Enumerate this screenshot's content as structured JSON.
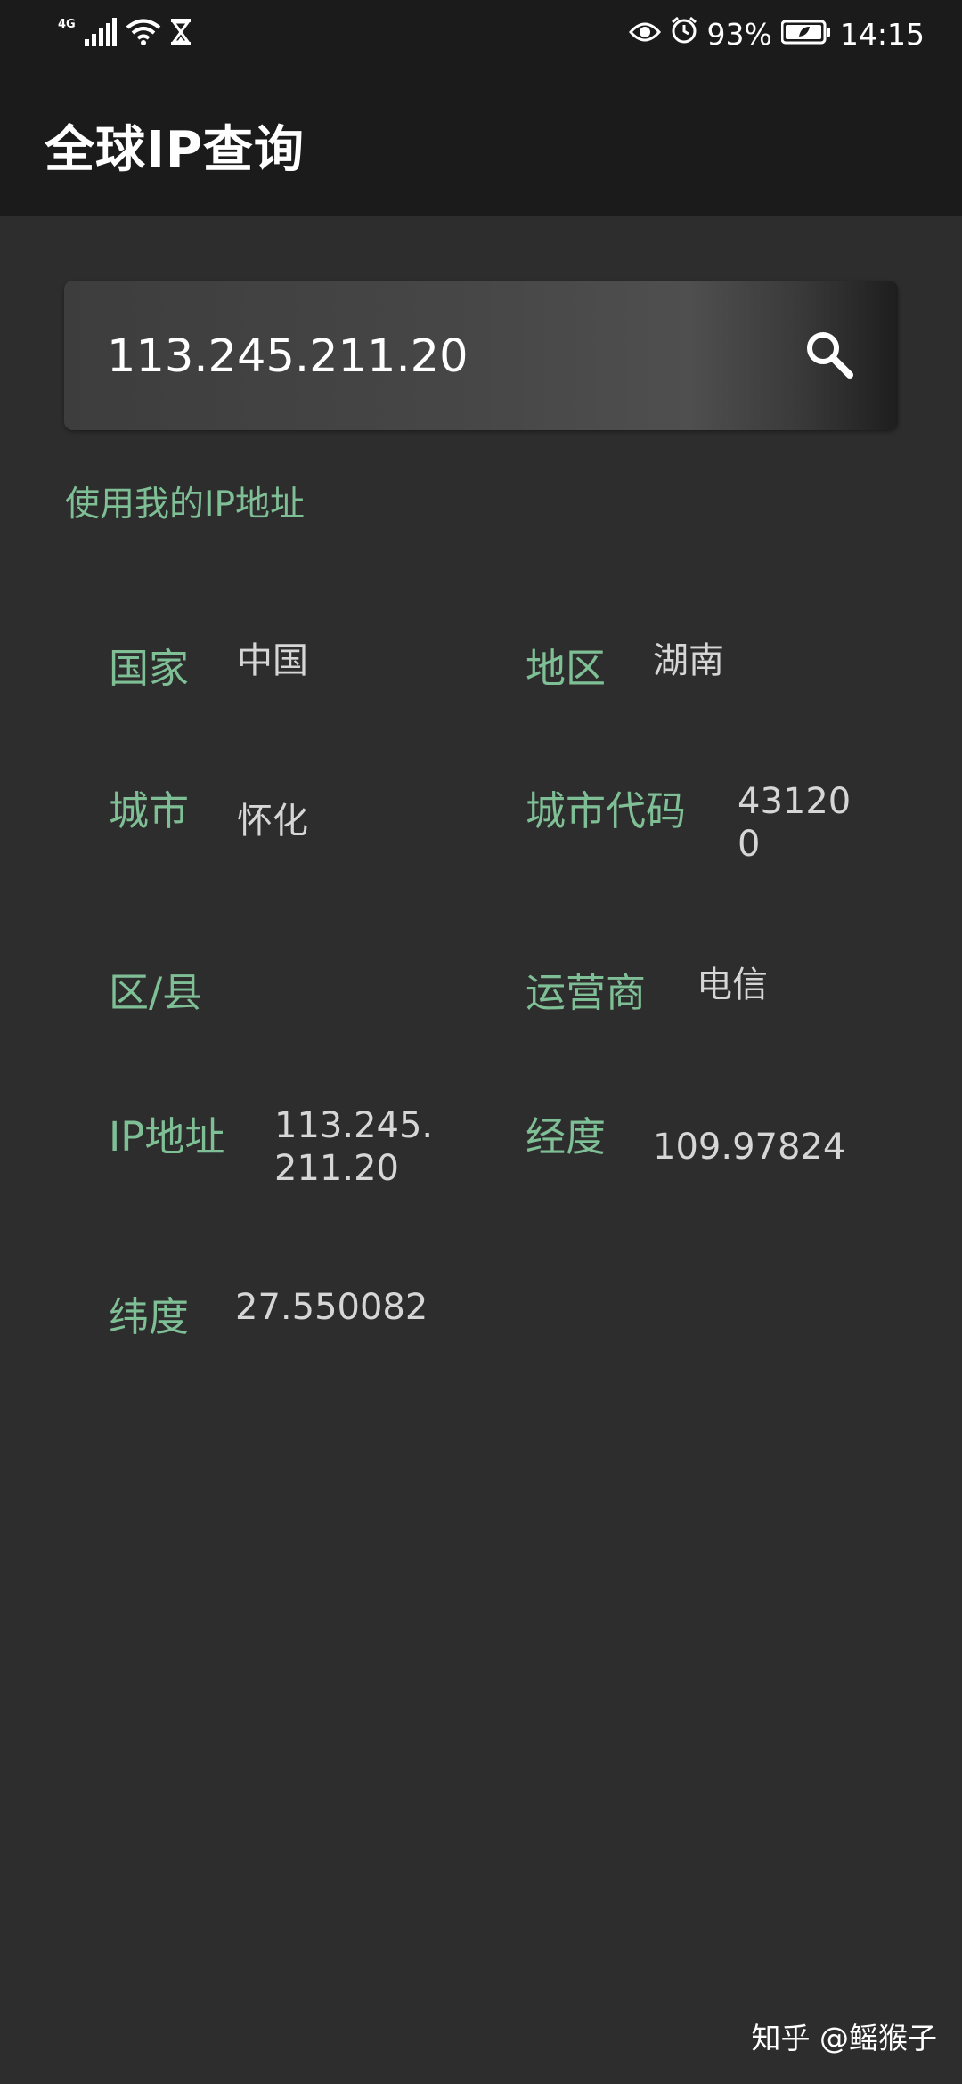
{
  "status_bar": {
    "network_type": "4G",
    "battery_percent": "93%",
    "time": "14:15",
    "icons": [
      "signal-icon",
      "wifi-icon",
      "hourglass-icon",
      "eye-icon",
      "alarm-icon",
      "battery-icon"
    ]
  },
  "app_bar": {
    "title": "全球IP查询"
  },
  "search": {
    "value": "113.245.211.20",
    "icon": "search-icon"
  },
  "use_my_ip_label": "使用我的IP地址",
  "fields": {
    "country": {
      "label": "国家",
      "value": "中国"
    },
    "region": {
      "label": "地区",
      "value": "湖南"
    },
    "city": {
      "label": "城市",
      "value": "怀化"
    },
    "city_code": {
      "label": "城市代码",
      "value_line1": "43120",
      "value_line2": "0"
    },
    "district": {
      "label": "区/县",
      "value": ""
    },
    "isp": {
      "label": "运营商",
      "value": "电信"
    },
    "ip": {
      "label": "IP地址",
      "value_line1": "113.245.",
      "value_line2": "211.20"
    },
    "longitude": {
      "label": "经度",
      "value": "109.97824"
    },
    "latitude": {
      "label": "纬度",
      "value": "27.550082"
    }
  },
  "watermark": "知乎 @鳐猴子",
  "colors": {
    "background": "#2d2d2d",
    "bar": "#1b1b1b",
    "accent_green": "#7fbf96",
    "value_text": "#d6d6d6"
  }
}
